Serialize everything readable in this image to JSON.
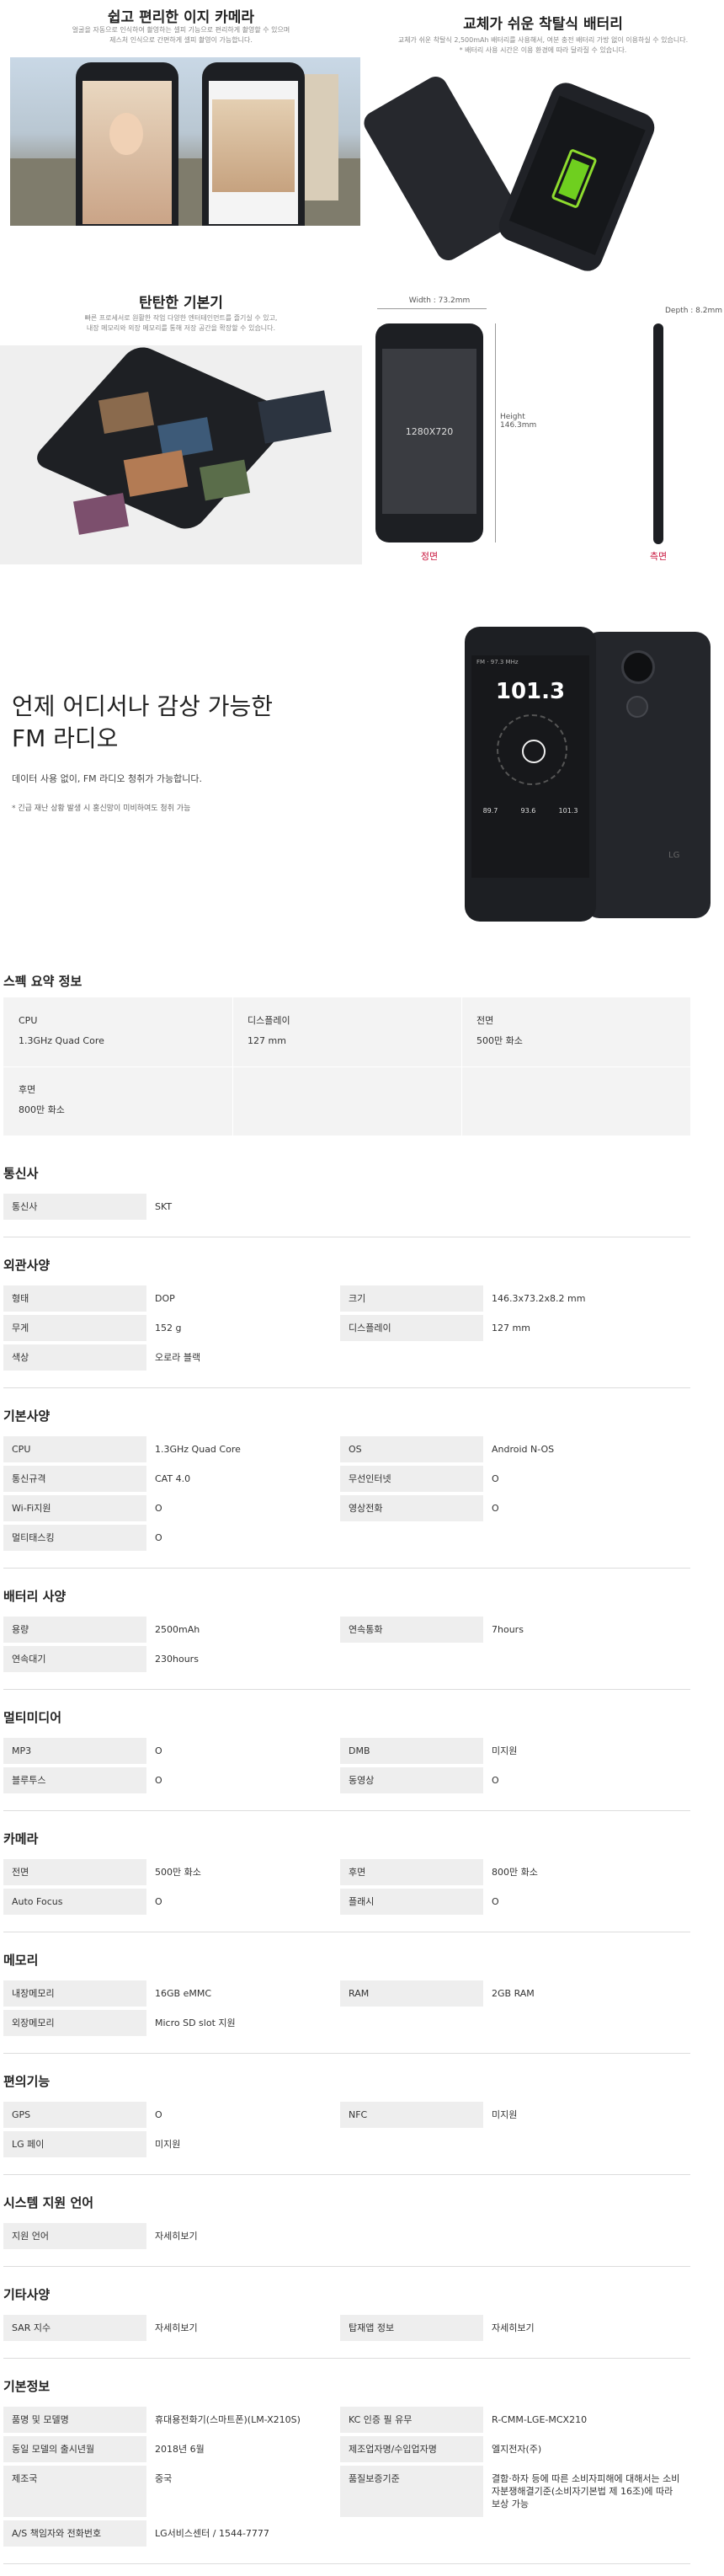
{
  "feature_camera": {
    "title": "쉽고 편리한 이지 카메라",
    "desc1": "얼굴을 자동으로 인식하여 촬영하는 셀피 기능으로 편리하게 촬영할 수 있으며",
    "desc2": "제스처 인식으로 간편하게 셀피 촬영이 가능합니다."
  },
  "feature_battery": {
    "title": "교체가 쉬운 착탈식 배터리",
    "desc1": "교체가 쉬운 착탈식 2,500mAh 배터리를 사용해서, 여분 충전 배터리 가방 없이 이용하실 수 있습니다.",
    "desc2": "* 배터리 사용 시간은 이용 환경에 따라 달라질 수 있습니다."
  },
  "feature_body": {
    "title": "탄탄한 기본기",
    "desc1": "빠른 프로세서로 원활한 작업 다양한 엔터테인먼트를 즐기실 수 있고,",
    "desc2": "내장 메모리와 외장 메모리를 통해 저장 공간을 확장할 수 있습니다."
  },
  "dimensions": {
    "width": "Width : 73.2mm",
    "height": "Height\n146.3mm",
    "depth": "Depth : 8.2mm",
    "screen": "1280X720",
    "front": "정면",
    "side": "측면"
  },
  "radio": {
    "title1": "언제 어디서나 감상 가능한",
    "title2": "FM 라디오",
    "desc": "데이터 사용 없이, FM 라디오 청취가 가능합니다.",
    "note": "* 긴급 재난 상황 발생 시 홍신망이 미비하여도 청취 가능",
    "freq": "101.3",
    "label": "FM · 97.3 MHz",
    "presets": [
      "89.7",
      "93.6",
      "101.3"
    ],
    "brand": "LG"
  },
  "summary": {
    "title": "스펙 요약 정보",
    "cells": [
      {
        "k": "CPU",
        "v": "1.3GHz Quad Core"
      },
      {
        "k": "디스플레이",
        "v": "127 mm"
      },
      {
        "k": "전면",
        "v": "500만 화소"
      },
      {
        "k": "후면",
        "v": "800만 화소"
      }
    ]
  },
  "sections": [
    {
      "title": "통신사",
      "rows": [
        [
          "통신사",
          "SKT",
          "",
          ""
        ]
      ]
    },
    {
      "title": "외관사양",
      "rows": [
        [
          "형태",
          "DOP",
          "크기",
          "146.3x73.2x8.2 mm"
        ],
        [
          "무게",
          "152 g",
          "디스플레이",
          "127 mm"
        ],
        [
          "색상",
          "오로라 블랙",
          "",
          ""
        ]
      ]
    },
    {
      "title": "기본사양",
      "rows": [
        [
          "CPU",
          "1.3GHz Quad Core",
          "OS",
          "Android N-OS"
        ],
        [
          "통신규격",
          "CAT 4.0",
          "무선인터넷",
          "O"
        ],
        [
          "Wi-Fi지원",
          "O",
          "영상전화",
          "O"
        ],
        [
          "멀티태스킹",
          "O",
          "",
          ""
        ]
      ]
    },
    {
      "title": "배터리 사양",
      "rows": [
        [
          "용량",
          "2500mAh",
          "연속통화",
          "7hours"
        ],
        [
          "연속대기",
          "230hours",
          "",
          ""
        ]
      ]
    },
    {
      "title": "멀티미디어",
      "rows": [
        [
          "MP3",
          "O",
          "DMB",
          "미지원"
        ],
        [
          "블루투스",
          "O",
          "동영상",
          "O"
        ]
      ]
    },
    {
      "title": "카메라",
      "rows": [
        [
          "전면",
          "500만 화소",
          "후면",
          "800만 화소"
        ],
        [
          "Auto Focus",
          "O",
          "플래시",
          "O"
        ]
      ]
    },
    {
      "title": "메모리",
      "rows": [
        [
          "내장메모리",
          "16GB eMMC",
          "RAM",
          "2GB RAM"
        ],
        [
          "외장메모리",
          "Micro SD slot 지원",
          "",
          ""
        ]
      ]
    },
    {
      "title": "편의기능",
      "rows": [
        [
          "GPS",
          "O",
          "NFC",
          "미지원"
        ],
        [
          "LG 페이",
          "미지원",
          "",
          ""
        ]
      ]
    },
    {
      "title": "시스템 지원 언어",
      "rows": [
        [
          "지원 언어",
          "자세히보기",
          "",
          ""
        ]
      ]
    },
    {
      "title": "기타사양",
      "rows": [
        [
          "SAR 지수",
          "자세히보기",
          "탑재앱 정보",
          "자세히보기"
        ]
      ]
    },
    {
      "title": "기본정보",
      "rows": [
        [
          "품명 및 모델명",
          "휴대용전화기(스마트폰)(LM-X210S)",
          "KC 인증 필 유무",
          "R-CMM-LGE-MCX210"
        ],
        [
          "동일 모델의 출시년월",
          "2018년 6월",
          "제조업자명/수입업자명",
          "엘지전자(주)"
        ],
        [
          "제조국",
          "중국",
          "품질보증기준",
          "결함·하자 등에 따른 소비자피해에 대해서는 소비자분쟁해결기준(소비자기본법 제 16조)에 따라 보상 가능"
        ],
        [
          "A/S 책임자와 전화번호",
          "LG서비스센터 / 1544-7777",
          "",
          ""
        ]
      ]
    }
  ]
}
